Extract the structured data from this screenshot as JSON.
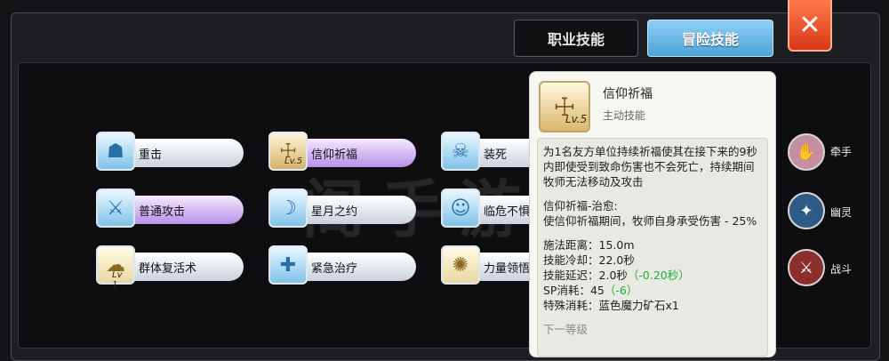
{
  "tabs": [
    {
      "label": "职业技能",
      "active": false
    },
    {
      "label": "冒险技能",
      "active": true
    }
  ],
  "close_glyph": "✕",
  "skills_left": [
    {
      "name": "重击"
    },
    {
      "name": "普通攻击"
    },
    {
      "name": "群体复活术",
      "level": "Lv 1"
    }
  ],
  "skills_mid": [
    {
      "name": "信仰祈福",
      "level": "Lv.5"
    },
    {
      "name": "星月之约"
    },
    {
      "name": "紧急治疗"
    }
  ],
  "skills_right": [
    {
      "name": "装死"
    },
    {
      "name": "临危不惧"
    },
    {
      "name": "力量领悟"
    }
  ],
  "round_skills": [
    {
      "name": "牵手",
      "color": "#c48fa3"
    },
    {
      "name": "幽灵",
      "color": "#2d5b86"
    },
    {
      "name": "战斗",
      "color": "#8a2e2e"
    }
  ],
  "tooltip": {
    "name": "信仰祈福",
    "level": "Lv.5",
    "type": "主动技能",
    "desc": "为1名友方单位持续祈福使其在接下来的9秒内即使受到致命伤害也不会死亡，持续期间牧师无法移动及攻击",
    "effect_title": "信仰祈福-治愈:",
    "effect_desc": "使信仰祈福期间，牧师自身承受伤害 - 25%",
    "range_label": "施法距离：",
    "range_value": "15.0m",
    "cooldown_label": "技能冷却：",
    "cooldown_value": "22.0秒",
    "delay_label": "技能延迟：",
    "delay_value": "2.0秒",
    "delay_bonus": "（-0.20秒）",
    "sp_label": "SP消耗：",
    "sp_value": "45",
    "sp_bonus": "（-6）",
    "special_label": "特殊消耗：",
    "special_value": "蓝色魔力矿石x1",
    "next_level": "下一等级"
  },
  "watermark": "阁手游"
}
